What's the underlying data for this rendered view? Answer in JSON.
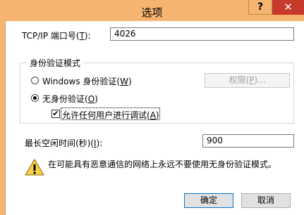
{
  "window": {
    "title": "选项",
    "help_glyph": "?",
    "close_glyph": "✕"
  },
  "tcp_port": {
    "label": "TCP/IP 端口号(",
    "hotkey": "T",
    "label_end": "):",
    "value": "4026"
  },
  "auth": {
    "group_title": "身份验证模式",
    "windows_label": "Windows 身份验证(",
    "windows_hotkey": "W",
    "windows_end": ")",
    "permissions_button": "权限(",
    "permissions_hotkey": "P",
    "permissions_end": ")...",
    "none_label": "无身份验证(",
    "none_hotkey": "O",
    "none_end": ")",
    "allow_all_label": "允许任何用户进行调试(",
    "allow_all_hotkey": "A",
    "allow_all_end": ")",
    "allow_all_checked": true,
    "selected": "none"
  },
  "idle_time": {
    "label": "最长空闲时间(秒)(",
    "hotkey": "I",
    "label_end": "):",
    "value": "900"
  },
  "warning_text": "在可能具有恶意通信的网络上永远不要使用无身份验证模式。",
  "buttons": {
    "ok": "确定",
    "cancel": "取消"
  },
  "colors": {
    "frame": "#f5b46f",
    "close": "#c7392b"
  }
}
